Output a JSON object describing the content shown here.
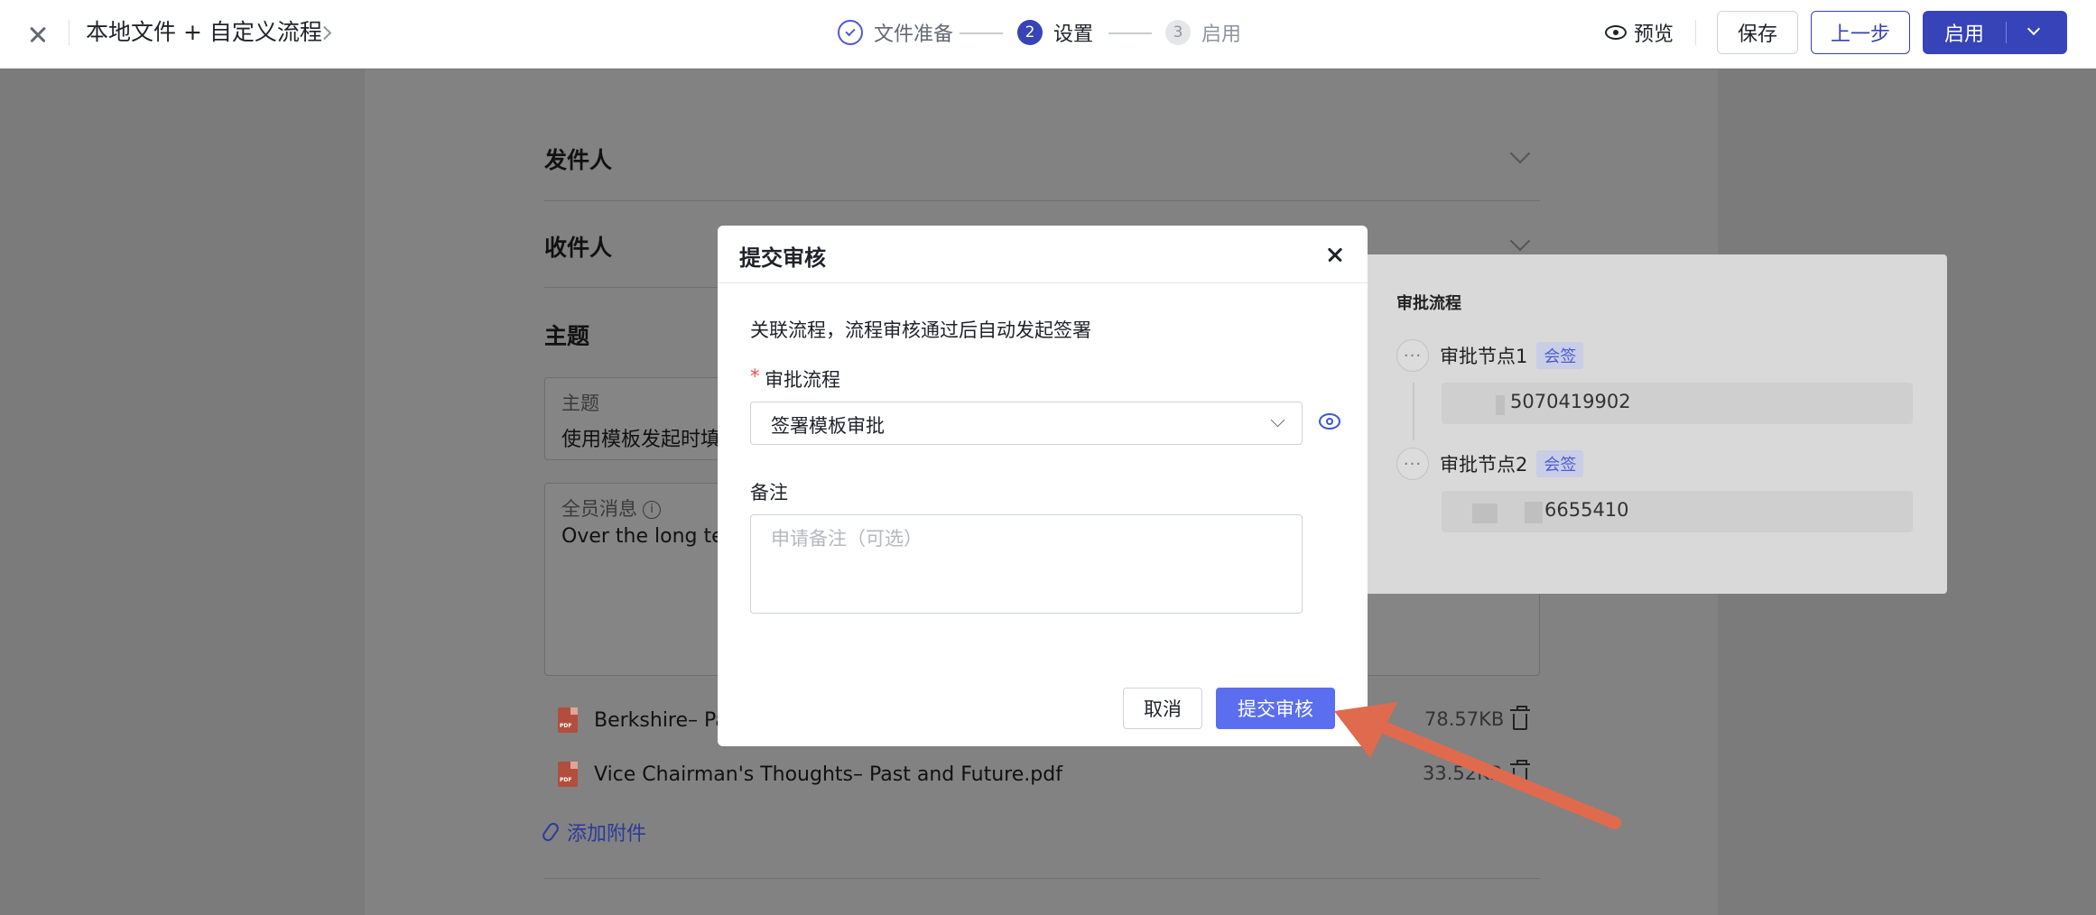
{
  "topbar": {
    "title": "本地文件 + 自定义流程",
    "steps": [
      {
        "number": "1",
        "label": "文件准备",
        "state": "done"
      },
      {
        "number": "2",
        "label": "设置",
        "state": "active"
      },
      {
        "number": "3",
        "label": "启用",
        "state": "pending"
      }
    ],
    "preview_label": "预览",
    "save_label": "保存",
    "prev_label": "上一步",
    "enable_label": "启用",
    "accent_color": "#3643b9"
  },
  "form": {
    "sender_section": "发件人",
    "recipient_section": "收件人",
    "subject_section": "主题",
    "subject_field_label": "主题",
    "subject_field_value": "使用模板发起时填写",
    "message_field_label": "全员消息",
    "message_field_value": "Over the long term",
    "attachments": [
      {
        "name": "Berkshire– Past",
        "size": "78.57KB"
      },
      {
        "name": "Vice Chairman's Thoughts– Past and Future.pdf",
        "size": "33.52KB"
      }
    ],
    "add_attachment_label": "添加附件"
  },
  "flow_panel": {
    "title": "审批流程",
    "nodes": [
      {
        "label": "审批节点1",
        "tag": "会签",
        "member": "5070419902"
      },
      {
        "label": "审批节点2",
        "tag": "会签",
        "member": "6655410"
      }
    ]
  },
  "modal": {
    "title": "提交审核",
    "description": "关联流程，流程审核通过后自动发起签署",
    "required_mark": "*",
    "flow_label": "审批流程",
    "flow_value": "签署模板审批",
    "note_label": "备注",
    "note_placeholder": "申请备注（可选）",
    "note_value": "",
    "cancel_label": "取消",
    "submit_label": "提交审核",
    "submit_color": "#5b6ef0"
  },
  "annotation": {
    "arrow_color": "#e06a4e"
  }
}
